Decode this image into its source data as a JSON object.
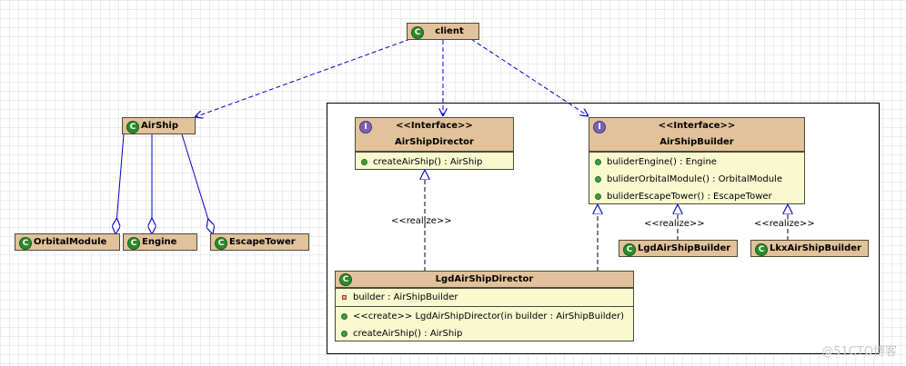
{
  "classes": {
    "client": {
      "name": "client"
    },
    "airship": {
      "name": "AirShip"
    },
    "orbital": {
      "name": "OrbitalModule"
    },
    "engine": {
      "name": "Engine"
    },
    "escape": {
      "name": "EscapeTower"
    },
    "director": {
      "stereotype": "<<Interface>>",
      "name": "AirShipDirector",
      "operations": [
        "createAirShip() : AirShip"
      ]
    },
    "builder": {
      "stereotype": "<<Interface>>",
      "name": "AirShipBuilder",
      "operations": [
        "buliderEngine() : Engine",
        "buliderOrbitalModule() : OrbitalModule",
        "buliderEscapeTower() : EscapeTower"
      ]
    },
    "lgd_builder": {
      "name": "LgdAirShipBuilder"
    },
    "lkx_builder": {
      "name": "LkxAirShipBuilder"
    },
    "lgd_director": {
      "name": "LgdAirShipDirector",
      "attributes": [
        "builder : AirShipBuilder"
      ],
      "operations": [
        "<<create>> LgdAirShipDirector(in builder : AirShipBuilder)",
        "createAirShip() : AirShip"
      ]
    }
  },
  "labels": {
    "realize": "<<realize>>"
  },
  "badges": {
    "class": "C",
    "interface": "I"
  },
  "icons": {
    "class": "class-icon",
    "interface": "interface-icon"
  },
  "colors": {
    "header": "#e2c29a",
    "body": "#f9f9d0",
    "line": "#0000cc",
    "realize_line": "#000000"
  },
  "watermark": "@51CTO博客"
}
